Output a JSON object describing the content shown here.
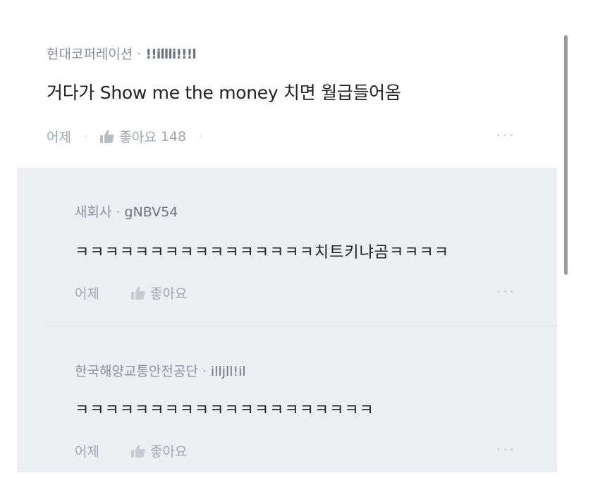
{
  "comments": [
    {
      "author": "현대코퍼레이션",
      "user_id": "!!illli!!!l",
      "text": "거다가 Show me the money 치면 월급들어옴",
      "date": "어제",
      "like_label": "좋아요",
      "like_count": "148",
      "more": "···"
    }
  ],
  "replies": [
    {
      "author": "새회사",
      "user_id": "gNBV54",
      "text": "ㅋㅋㅋㅋㅋㅋㅋㅋㅋㅋㅋㅋㅋㅋㅋㅋ치트키냐곰ㅋㅋㅋㅋ",
      "date": "어제",
      "like_label": "좋아요",
      "more": "···"
    },
    {
      "author": "한국해양교통안전공단",
      "user_id": "illjll!il",
      "text": "ㅋㅋㅋㅋㅋㅋㅋㅋㅋㅋㅋㅋㅋㅋㅋㅋㅋㅋㅋㅋ",
      "date": "어제",
      "like_label": "좋아요",
      "more": "···"
    }
  ],
  "separator": "·",
  "colors": {
    "reply_background": "#eceef2",
    "meta_text": "#8b8f98",
    "body_text": "#222222"
  }
}
